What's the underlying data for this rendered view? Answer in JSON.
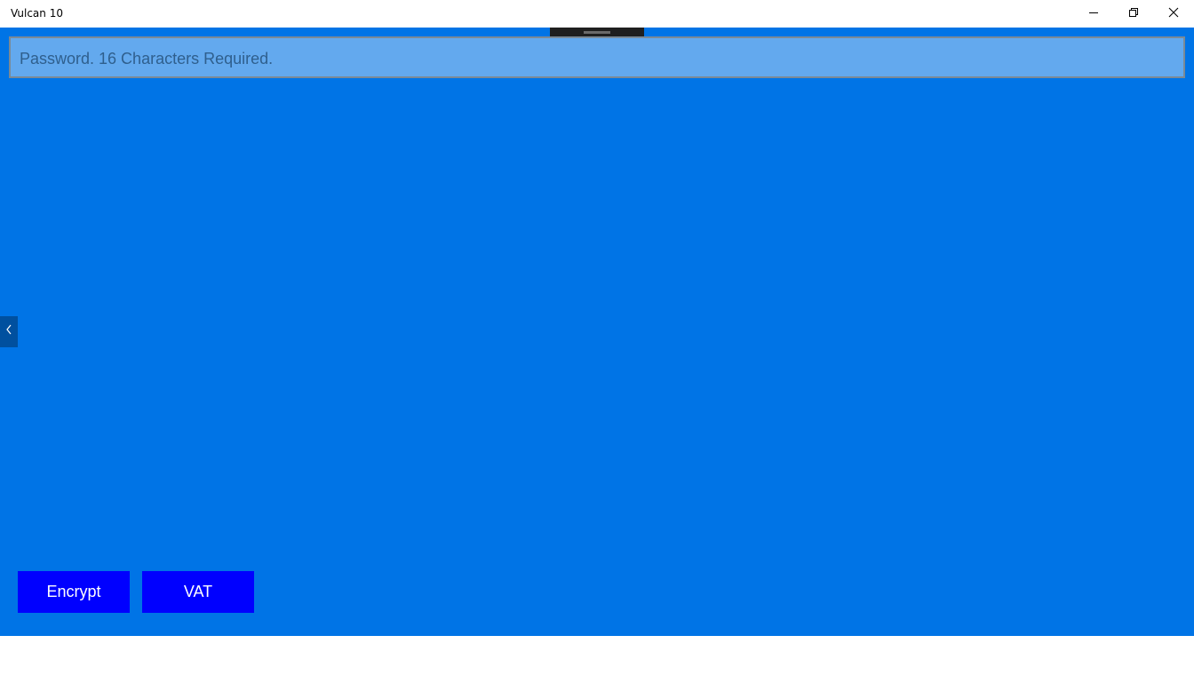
{
  "window": {
    "title": "Vulcan 10",
    "controls": {
      "minimize_icon": "minimize-icon",
      "restore_icon": "restore-icon",
      "close_icon": "close-icon"
    }
  },
  "form": {
    "password_placeholder": "Password. 16 Characters Required.",
    "password_value": ""
  },
  "side_toggle": {
    "icon": "chevron-left-icon"
  },
  "actions": {
    "encrypt_label": "Encrypt",
    "vat_label": "VAT"
  },
  "colors": {
    "canvas_background": "#0074E6",
    "input_background": "#63A9EE",
    "button_background": "#0000FF",
    "button_text": "#FFFFFF",
    "side_toggle_background": "#00509F",
    "drag_handle": "#1F1F1F"
  }
}
